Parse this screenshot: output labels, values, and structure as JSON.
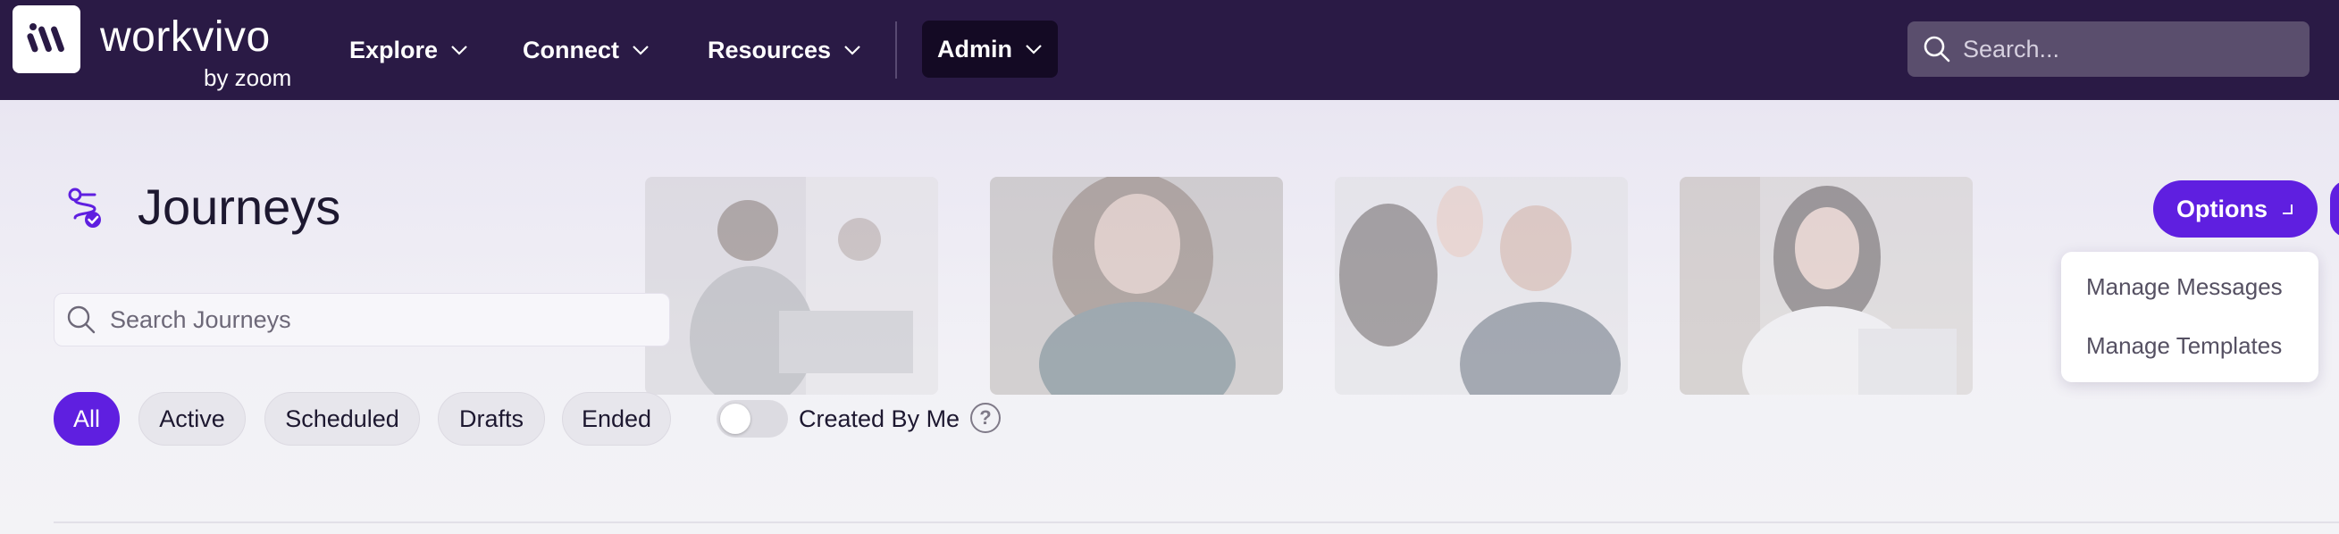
{
  "nav": {
    "brand": "workvivo",
    "brand_sub": "by zoom",
    "items": [
      {
        "label": "Explore"
      },
      {
        "label": "Connect"
      },
      {
        "label": "Resources"
      }
    ],
    "admin_label": "Admin",
    "search_placeholder": "Search..."
  },
  "page": {
    "title": "Journeys",
    "search_placeholder": "Search Journeys",
    "options_label": "Options",
    "dropdown": [
      "Manage Messages",
      "Manage Templates"
    ],
    "filters": [
      {
        "label": "All",
        "active": true
      },
      {
        "label": "Active",
        "active": false
      },
      {
        "label": "Scheduled",
        "active": false
      },
      {
        "label": "Drafts",
        "active": false
      },
      {
        "label": "Ended",
        "active": false
      }
    ],
    "toggle_label": "Created By Me",
    "toggle_on": false,
    "help_glyph": "?"
  },
  "icons": {
    "logo": "workvivo-logo-icon",
    "search": "search-icon",
    "chevron": "chevron-down-icon",
    "journey": "journey-icon",
    "help": "help-icon"
  },
  "colors": {
    "topbar": "#2a1a45",
    "accent": "#5f1fe0",
    "admin_bg": "#140a24"
  }
}
